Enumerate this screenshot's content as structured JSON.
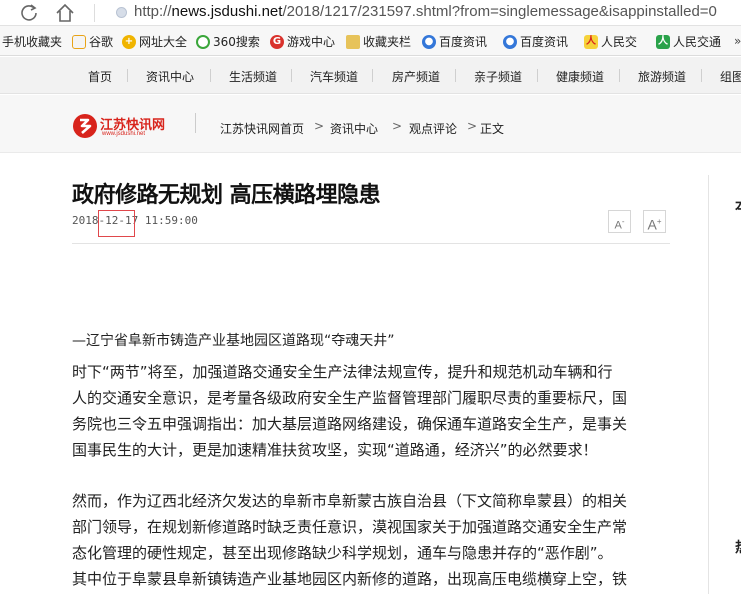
{
  "browser": {
    "url_scheme": "http://",
    "url_host": "news.jsdushi.net",
    "url_path": "/2018/1217/231597.shtml?from=singlemessage&isappinstalled=0"
  },
  "favorites": [
    {
      "label": "手机收藏夹",
      "icon": "none",
      "color": ""
    },
    {
      "label": "谷歌",
      "icon": "page-icon",
      "color": "#e8a317"
    },
    {
      "label": "网址大全",
      "icon": "gift-icon",
      "color": "#f0b400"
    },
    {
      "label": "360搜索",
      "icon": "ring-icon",
      "color": "#3aa63a"
    },
    {
      "label": "游戏中心",
      "icon": "game-icon",
      "color": "#d9322c"
    },
    {
      "label": "收藏夹栏",
      "icon": "folder-icon",
      "color": "#e7c35a"
    },
    {
      "label": "百度资讯",
      "icon": "paw-icon",
      "color": "#3477d9"
    },
    {
      "label": "百度资讯",
      "icon": "paw-icon",
      "color": "#3477d9"
    },
    {
      "label": "人民交",
      "icon": "renmin-icon",
      "color": "#d8241c"
    },
    {
      "label": "人民交通",
      "icon": "tv-icon",
      "color": "#2aa24a"
    }
  ],
  "sitenav": [
    "首页",
    "资讯中心",
    "生活频道",
    "汽车频道",
    "房产频道",
    "亲子频道",
    "健康频道",
    "旅游频道",
    "组图"
  ],
  "logo": {
    "name": "江苏快讯网",
    "sub": "www.jsdushi.net"
  },
  "breadcrumb": [
    "江苏快讯网首页",
    "资讯中心",
    "观点评论",
    "正文"
  ],
  "breadcrumb_sep": ">",
  "article": {
    "title": "政府修路无规划 高压横路埋隐患",
    "date": "2018-12-17 11:59:00",
    "font_small": "A",
    "font_large": "A",
    "subhead": "—辽宁省阜新市铸造产业基地园区道路现“夺魂天井”",
    "paragraphs": [
      [
        "时下“两节”将至，加强道路交通安全生产法律法规宣传，提升和规范机动车辆和行",
        "人的交通安全意识，是考量各级政府安全生产监督管理部门履职尽责的重要标尺，国",
        "务院也三令五申强调指出：加大基层道路网络建设，确保通车道路安全生产，是事关",
        "国事民生的大计，更是加速精准扶贫攻坚，实现“道路通，经济兴”的必然要求！"
      ],
      [
        "然而，作为辽西北经济欠发达的阜新市阜新蒙古族自治县（下文简称阜蒙县）的相关",
        "部门领导，在规划新修道路时缺乏责任意识，漠视国家关于加强道路交通安全生产常",
        "态化管理的硬性规定，甚至出现修路缺少科学规划，通车与隐患并存的“恶作剧”。",
        "其中位于阜蒙县阜新镇铸造产业基地园区内新修的道路，出现高压电缆横穿上空，铁"
      ]
    ]
  },
  "sidebar": {
    "frag_top": "本",
    "frag_bottom": "热"
  }
}
